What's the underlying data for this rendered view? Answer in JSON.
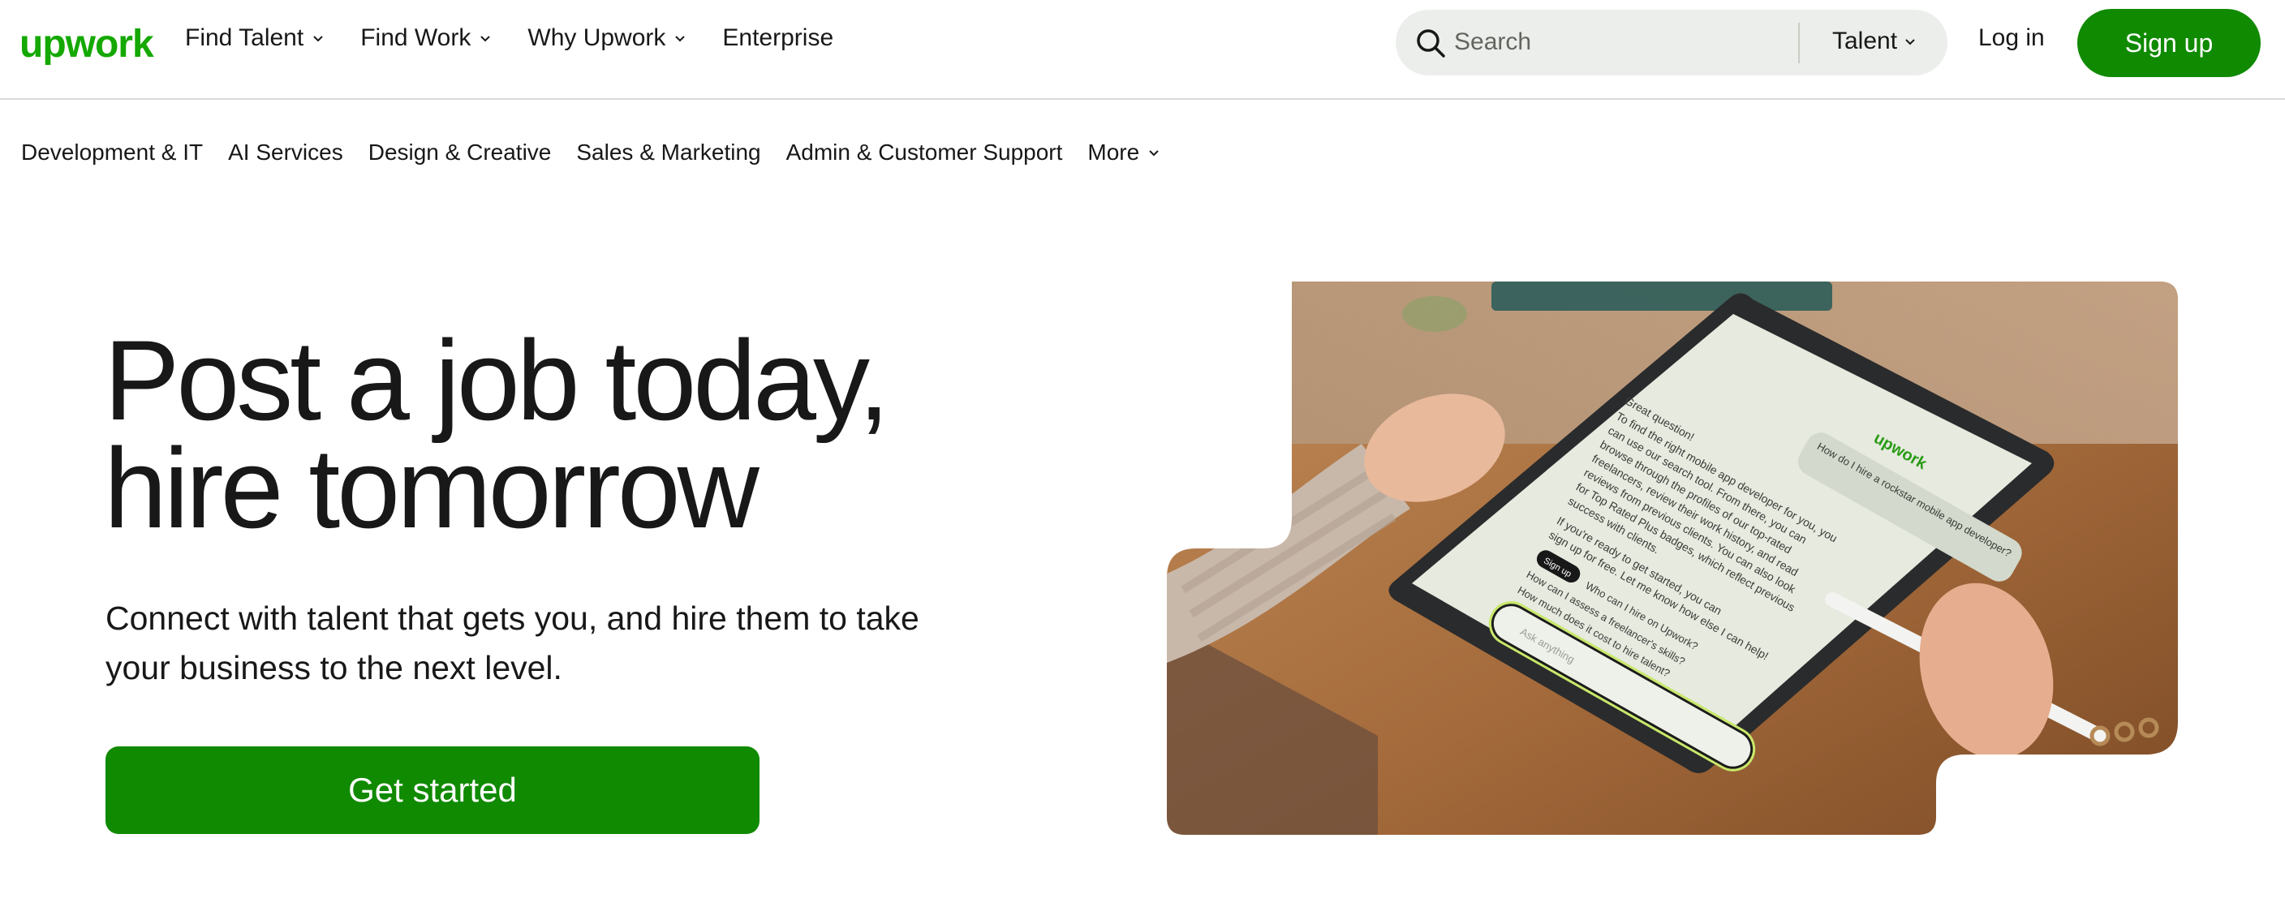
{
  "brand": {
    "logo_text": "upwork",
    "color": "#14a800"
  },
  "nav": {
    "links": [
      {
        "label": "Find Talent",
        "has_dropdown": true
      },
      {
        "label": "Find Work",
        "has_dropdown": true
      },
      {
        "label": "Why Upwork",
        "has_dropdown": true
      },
      {
        "label": "Enterprise",
        "has_dropdown": false
      }
    ],
    "search": {
      "placeholder": "Search",
      "scope": "Talent"
    },
    "login_label": "Log in",
    "signup_label": "Sign up"
  },
  "categories": [
    {
      "label": "Development & IT"
    },
    {
      "label": "AI Services"
    },
    {
      "label": "Design & Creative"
    },
    {
      "label": "Sales & Marketing"
    },
    {
      "label": "Admin & Customer Support"
    },
    {
      "label": "More",
      "has_dropdown": true
    }
  ],
  "hero": {
    "title_line1": "Post a job today,",
    "title_line2": "hire tomorrow",
    "subtitle": "Connect with talent that gets you, and hire them to take your business to the next level.",
    "cta_label": "Get started",
    "image_alt": "Person using Upwork assistant on a tablet"
  },
  "tablet_screen": {
    "logo": "upwork",
    "user_message": "How do I hire a rockstar mobile app developer?",
    "reply_lines": [
      "Great question!",
      "To find the right mobile app developer for you, you",
      "can use our search tool. From there, you can",
      "browse through the profiles of our top-rated",
      "freelancers, review their work history, and read",
      "reviews from previous clients. You can also look",
      "for Top Rated Plus badges, which reflect previous",
      "success with clients.",
      "If you're ready to get started, you can",
      "sign up for free. Let me know how else I can help!"
    ],
    "signup_chip": "Sign up",
    "suggestions": [
      "Who can I hire on Upwork?",
      "How can I assess a freelancer's skills?",
      "How much does it cost to hire talent?"
    ],
    "input_placeholder": "Ask anything"
  },
  "colors": {
    "primary_green": "#108a00",
    "text": "#181818",
    "search_bg": "#ebeeea"
  },
  "icons": {
    "search": "search-icon",
    "dropdown": "chevron-down-icon"
  }
}
